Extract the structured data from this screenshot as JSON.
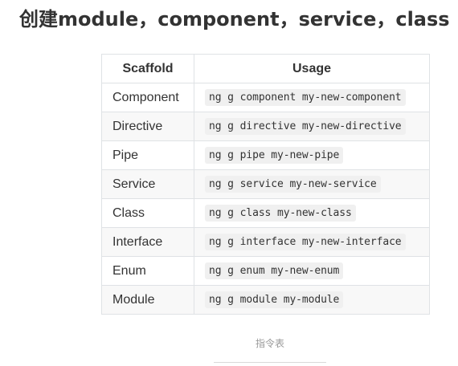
{
  "page": {
    "title": "创建module，component，service，class"
  },
  "table": {
    "headers": [
      "Scaffold",
      "Usage"
    ],
    "rows": [
      {
        "scaffold": "Component",
        "usage": "ng g component my-new-component"
      },
      {
        "scaffold": "Directive",
        "usage": "ng g directive my-new-directive"
      },
      {
        "scaffold": "Pipe",
        "usage": "ng g pipe my-new-pipe"
      },
      {
        "scaffold": "Service",
        "usage": "ng g service my-new-service"
      },
      {
        "scaffold": "Class",
        "usage": "ng g class my-new-class"
      },
      {
        "scaffold": "Interface",
        "usage": "ng g interface my-new-interface"
      },
      {
        "scaffold": "Enum",
        "usage": "ng g enum my-new-enum"
      },
      {
        "scaffold": "Module",
        "usage": "ng g module my-module"
      }
    ]
  },
  "caption": "指令表"
}
